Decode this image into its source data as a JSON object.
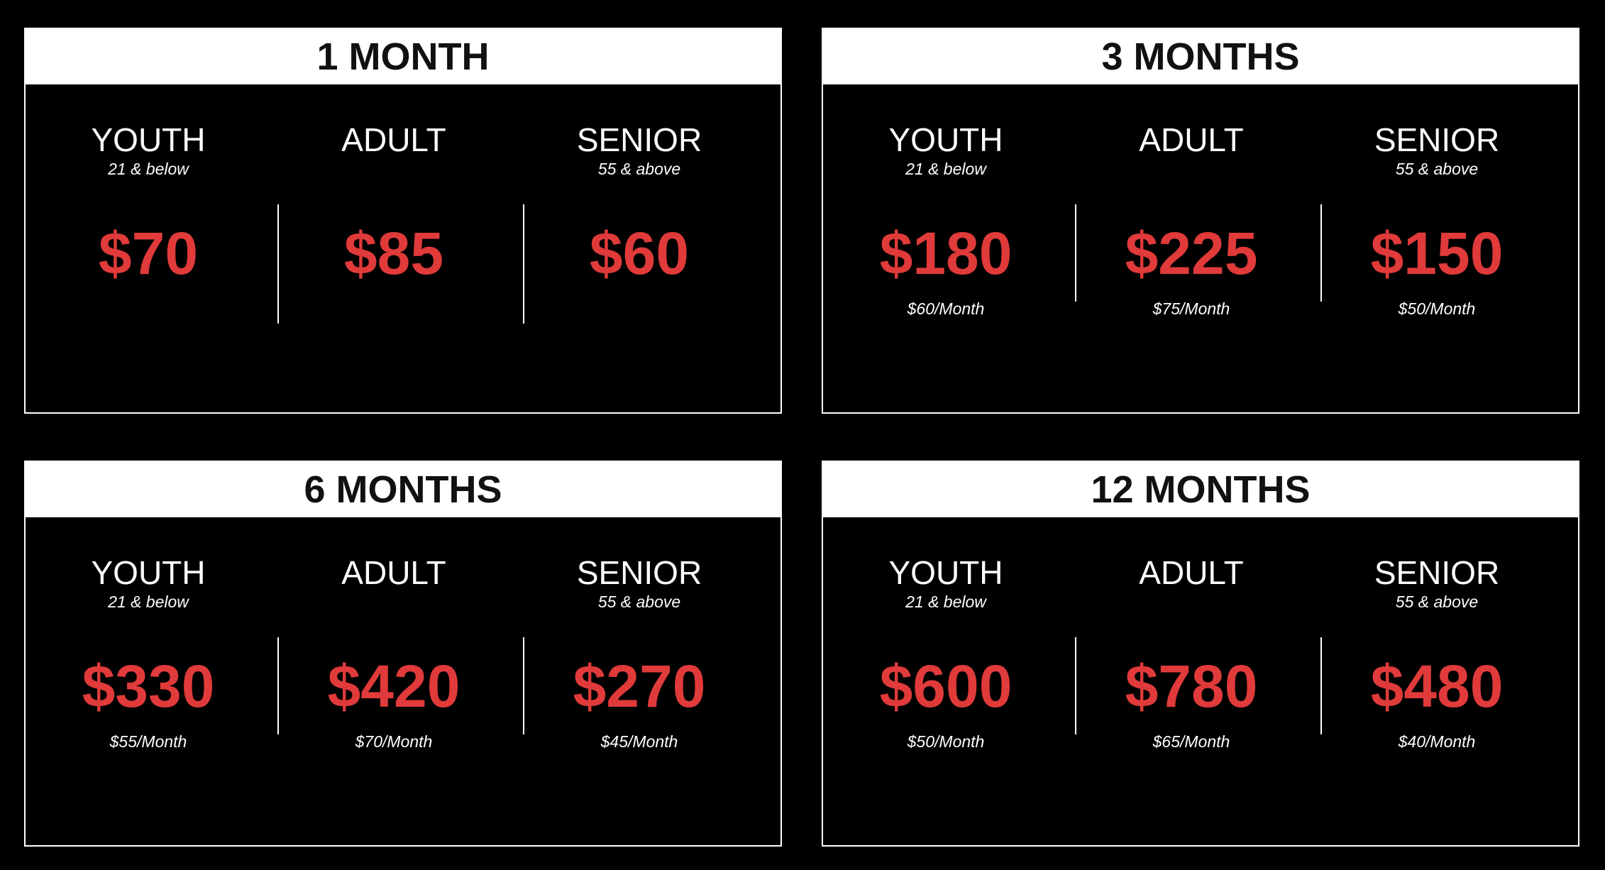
{
  "colors": {
    "background": "#000000",
    "header_background": "#ffffff",
    "price": "#e03a3a"
  },
  "plans": [
    {
      "title": "1 MONTH",
      "tiers": [
        {
          "name": "YOUTH",
          "sub": "21 & below",
          "price": "$70",
          "monthly": ""
        },
        {
          "name": "ADULT",
          "sub": "",
          "price": "$85",
          "monthly": ""
        },
        {
          "name": "SENIOR",
          "sub": "55 & above",
          "price": "$60",
          "monthly": ""
        }
      ]
    },
    {
      "title": "3 MONTHS",
      "tiers": [
        {
          "name": "YOUTH",
          "sub": "21 & below",
          "price": "$180",
          "monthly": "$60/Month"
        },
        {
          "name": "ADULT",
          "sub": "",
          "price": "$225",
          "monthly": "$75/Month"
        },
        {
          "name": "SENIOR",
          "sub": "55 & above",
          "price": "$150",
          "monthly": "$50/Month"
        }
      ]
    },
    {
      "title": "6 MONTHS",
      "tiers": [
        {
          "name": "YOUTH",
          "sub": "21 & below",
          "price": "$330",
          "monthly": "$55/Month"
        },
        {
          "name": "ADULT",
          "sub": "",
          "price": "$420",
          "monthly": "$70/Month"
        },
        {
          "name": "SENIOR",
          "sub": "55 & above",
          "price": "$270",
          "monthly": "$45/Month"
        }
      ]
    },
    {
      "title": "12 MONTHS",
      "tiers": [
        {
          "name": "YOUTH",
          "sub": "21 & below",
          "price": "$600",
          "monthly": "$50/Month"
        },
        {
          "name": "ADULT",
          "sub": "",
          "price": "$780",
          "monthly": "$65/Month"
        },
        {
          "name": "SENIOR",
          "sub": "55 & above",
          "price": "$480",
          "monthly": "$40/Month"
        }
      ]
    }
  ]
}
